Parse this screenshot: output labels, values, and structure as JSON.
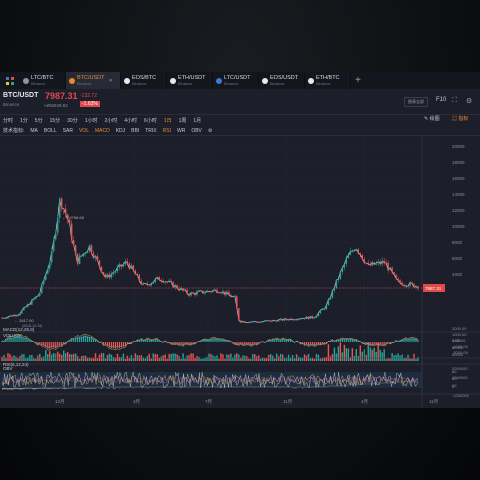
{
  "tabs": [
    {
      "name": "LTC/BTC",
      "exchange": "Binance",
      "color": "#8a94a6"
    },
    {
      "name": "BTC/USDT",
      "exchange": "Binance",
      "color": "#f0862e",
      "active": true
    },
    {
      "name": "EOS/BTC",
      "exchange": "Binance",
      "color": "#e7e9ee"
    },
    {
      "name": "ETH/USDT",
      "exchange": "Binance",
      "color": "#e7e9ee"
    },
    {
      "name": "LTC/USDT",
      "exchange": "Binance",
      "color": "#3b7ad8"
    },
    {
      "name": "EOS/USDT",
      "exchange": "Binance",
      "color": "#e7e9ee"
    },
    {
      "name": "ETH/BTC",
      "exchange": "Binance",
      "color": "#e7e9ee"
    }
  ],
  "header": {
    "pair": "BTC/USDT",
    "exchange": "Binance",
    "price": "7987.31",
    "cny": "≈¥56949.52",
    "change": "-132.72",
    "change_pct": "-1.63%",
    "fullscreen_btn": "图表全部",
    "f10": "F10"
  },
  "intervals": [
    "分时",
    "1分",
    "5分",
    "15分",
    "30分",
    "1小时",
    "2小时",
    "4小时",
    "6小时",
    "1日",
    "1周",
    "1月"
  ],
  "selected_interval": "1日",
  "right_tools": {
    "draw": "绘图",
    "indicator": "指标"
  },
  "indicator_label": "技术指标:",
  "indicators": [
    "MA",
    "BOLL",
    "SAR",
    "VOL",
    "MACD",
    "KDJ",
    "BBI",
    "TRIX",
    "RSI",
    "WR",
    "OBV"
  ],
  "highlighted_indicators": [
    "VOL",
    "MACD",
    "RSI"
  ],
  "main_chart": {
    "high_label": "19798.68",
    "low_label": "2817.00",
    "low_sub": "(2018-12-15)",
    "current_price_tag": "7987.31",
    "y_ticks": [
      "20000",
      "18000",
      "16000",
      "14000",
      "12000",
      "10000",
      "8000",
      "6000",
      "4000"
    ]
  },
  "panels": {
    "vol": {
      "title": "VOLUME",
      "ticks": [
        "120000",
        "80000",
        "40000"
      ]
    },
    "obv": {
      "title": "OBV",
      "ticks": [
        "2000000",
        "1000000",
        "0",
        "-1000000"
      ]
    },
    "macd": {
      "title": "MACD(12,26,9)",
      "ticks": [
        "2000.00",
        "1000.00",
        "0.00",
        "-1000.00",
        "-2000.00"
      ]
    },
    "rsi": {
      "title": "RSI(6,12,24)",
      "ticks": [
        "80",
        "50",
        "20"
      ]
    }
  },
  "x_axis": [
    "12月",
    "3月",
    "7月",
    "11月",
    "4月",
    "11月"
  ],
  "colors": {
    "up": "#26a69a",
    "down": "#ef5350",
    "accent": "#e98a35",
    "price_line": "#e04849"
  }
}
